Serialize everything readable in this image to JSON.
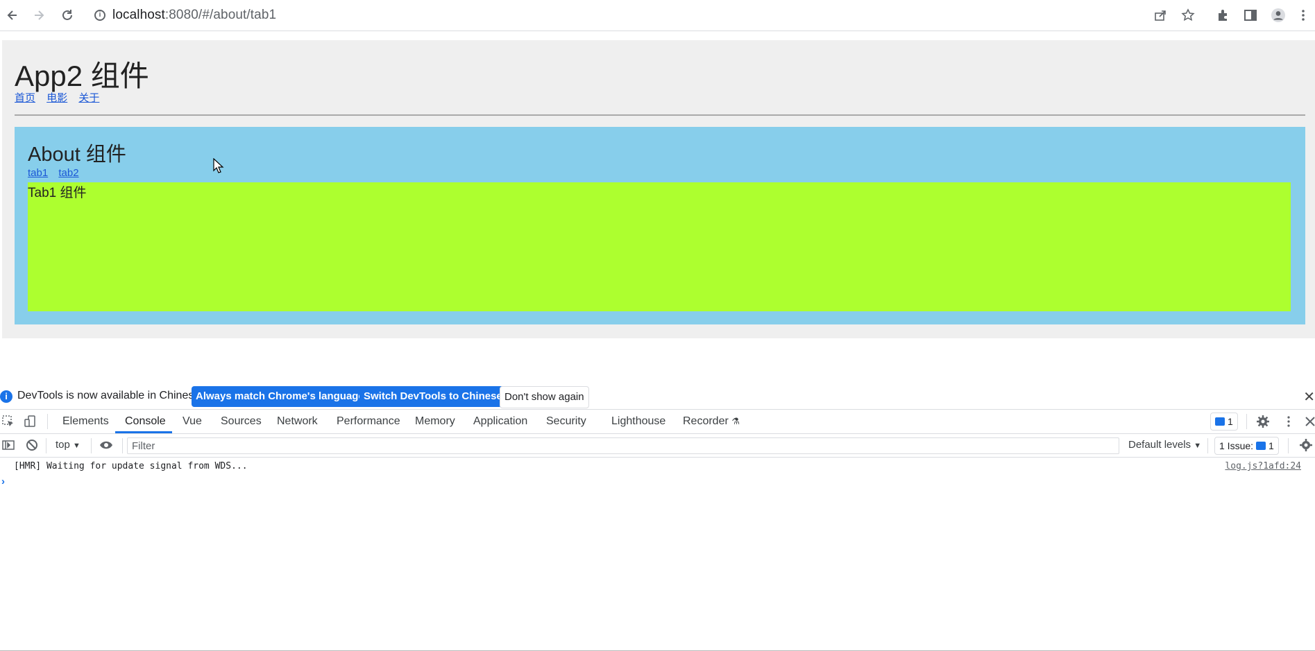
{
  "browser": {
    "url_host": "localhost",
    "url_path": ":8080/#/about/tab1"
  },
  "app": {
    "title": "App2 组件",
    "nav": [
      "首页",
      "电影",
      "关于"
    ]
  },
  "about": {
    "title": "About 组件",
    "tabs": [
      "tab1",
      "tab2"
    ],
    "content": "Tab1 组件"
  },
  "colors": {
    "app_bg": "#efefef",
    "about_bg": "#87ceeb",
    "tab_bg": "#adff2f",
    "accent": "#1a73e8"
  },
  "devtools": {
    "infobar": {
      "text": "DevTools is now available in Chinese!",
      "btn_match": "Always match Chrome's language",
      "btn_switch": "Switch DevTools to Chinese",
      "btn_dismiss": "Don't show again"
    },
    "tabs": [
      "Elements",
      "Console",
      "Vue",
      "Sources",
      "Network",
      "Performance",
      "Memory",
      "Application",
      "Security",
      "Lighthouse",
      "Recorder"
    ],
    "active_tab": "Console",
    "message_count": "1",
    "context": "top",
    "filter_placeholder": "Filter",
    "levels": "Default levels",
    "issues_label": "1 Issue:",
    "issues_count": "1",
    "log": {
      "text": "[HMR] Waiting for update signal from WDS...",
      "source": "log.js?1afd:24"
    }
  }
}
